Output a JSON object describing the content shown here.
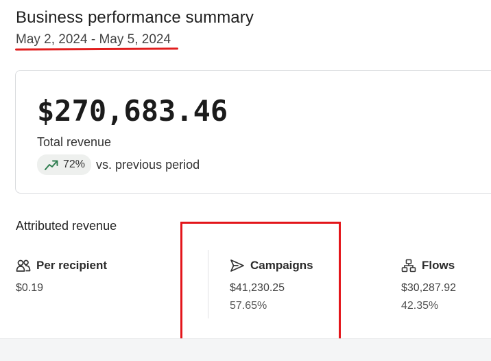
{
  "header": {
    "title": "Business performance summary",
    "date_range": "May 2, 2024 - May 5, 2024"
  },
  "revenue": {
    "amount": "$270,683.46",
    "label": "Total revenue",
    "change_percent": "72%",
    "change_text": "vs. previous period",
    "change_icon": "trending-up-icon"
  },
  "attributed": {
    "title": "Attributed revenue",
    "metrics": [
      {
        "label": "Per recipient",
        "icon": "people-icon",
        "value": "$0.19",
        "percent": ""
      },
      {
        "label": "Campaigns",
        "icon": "send-icon",
        "value": "$41,230.25",
        "percent": "57.65%"
      },
      {
        "label": "Flows",
        "icon": "flow-icon",
        "value": "$30,287.92",
        "percent": "42.35%"
      }
    ]
  },
  "colors": {
    "annotation_red": "#e3151a",
    "trend_green": "#2e7d4f",
    "card_border": "#d9dbde"
  }
}
